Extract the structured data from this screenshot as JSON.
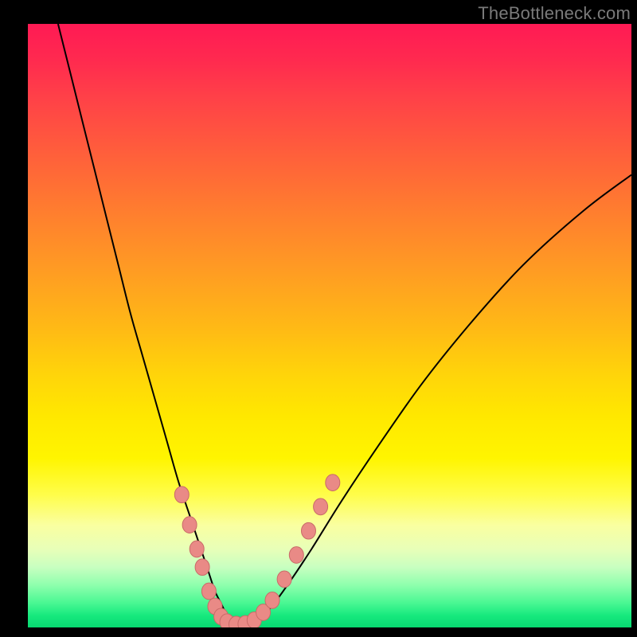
{
  "watermark": "TheBottleneck.com",
  "colors": {
    "curve_stroke": "#000000",
    "dot_fill": "#e98a86",
    "dot_stroke": "#c96a68"
  },
  "chart_data": {
    "type": "line",
    "title": "",
    "xlabel": "",
    "ylabel": "",
    "xlim": [
      0,
      100
    ],
    "ylim": [
      0,
      100
    ],
    "grid": false,
    "legend": false,
    "series": [
      {
        "name": "bottleneck-curve",
        "x": [
          5,
          7,
          9,
          11,
          13,
          15,
          17,
          19,
          21,
          23,
          25,
          27,
          29,
          30,
          31,
          32,
          33,
          34,
          36,
          38,
          40,
          43,
          47,
          52,
          58,
          65,
          73,
          82,
          92,
          100
        ],
        "y": [
          100,
          92,
          84,
          76,
          68,
          60,
          52,
          45,
          38,
          31,
          24,
          18,
          12,
          9,
          6,
          4,
          2,
          1,
          0.5,
          1,
          3,
          7,
          13,
          21,
          30,
          40,
          50,
          60,
          69,
          75
        ]
      }
    ],
    "dots": {
      "name": "highlight-dots",
      "points": [
        {
          "x": 25.5,
          "y": 22
        },
        {
          "x": 26.8,
          "y": 17
        },
        {
          "x": 28.0,
          "y": 13
        },
        {
          "x": 28.9,
          "y": 10
        },
        {
          "x": 30.0,
          "y": 6
        },
        {
          "x": 31.0,
          "y": 3.5
        },
        {
          "x": 32.0,
          "y": 1.8
        },
        {
          "x": 33.0,
          "y": 0.9
        },
        {
          "x": 34.5,
          "y": 0.5
        },
        {
          "x": 36.0,
          "y": 0.6
        },
        {
          "x": 37.5,
          "y": 1.2
        },
        {
          "x": 39.0,
          "y": 2.5
        },
        {
          "x": 40.5,
          "y": 4.5
        },
        {
          "x": 42.5,
          "y": 8
        },
        {
          "x": 44.5,
          "y": 12
        },
        {
          "x": 46.5,
          "y": 16
        },
        {
          "x": 48.5,
          "y": 20
        },
        {
          "x": 50.5,
          "y": 24
        }
      ],
      "radius": 9
    }
  }
}
